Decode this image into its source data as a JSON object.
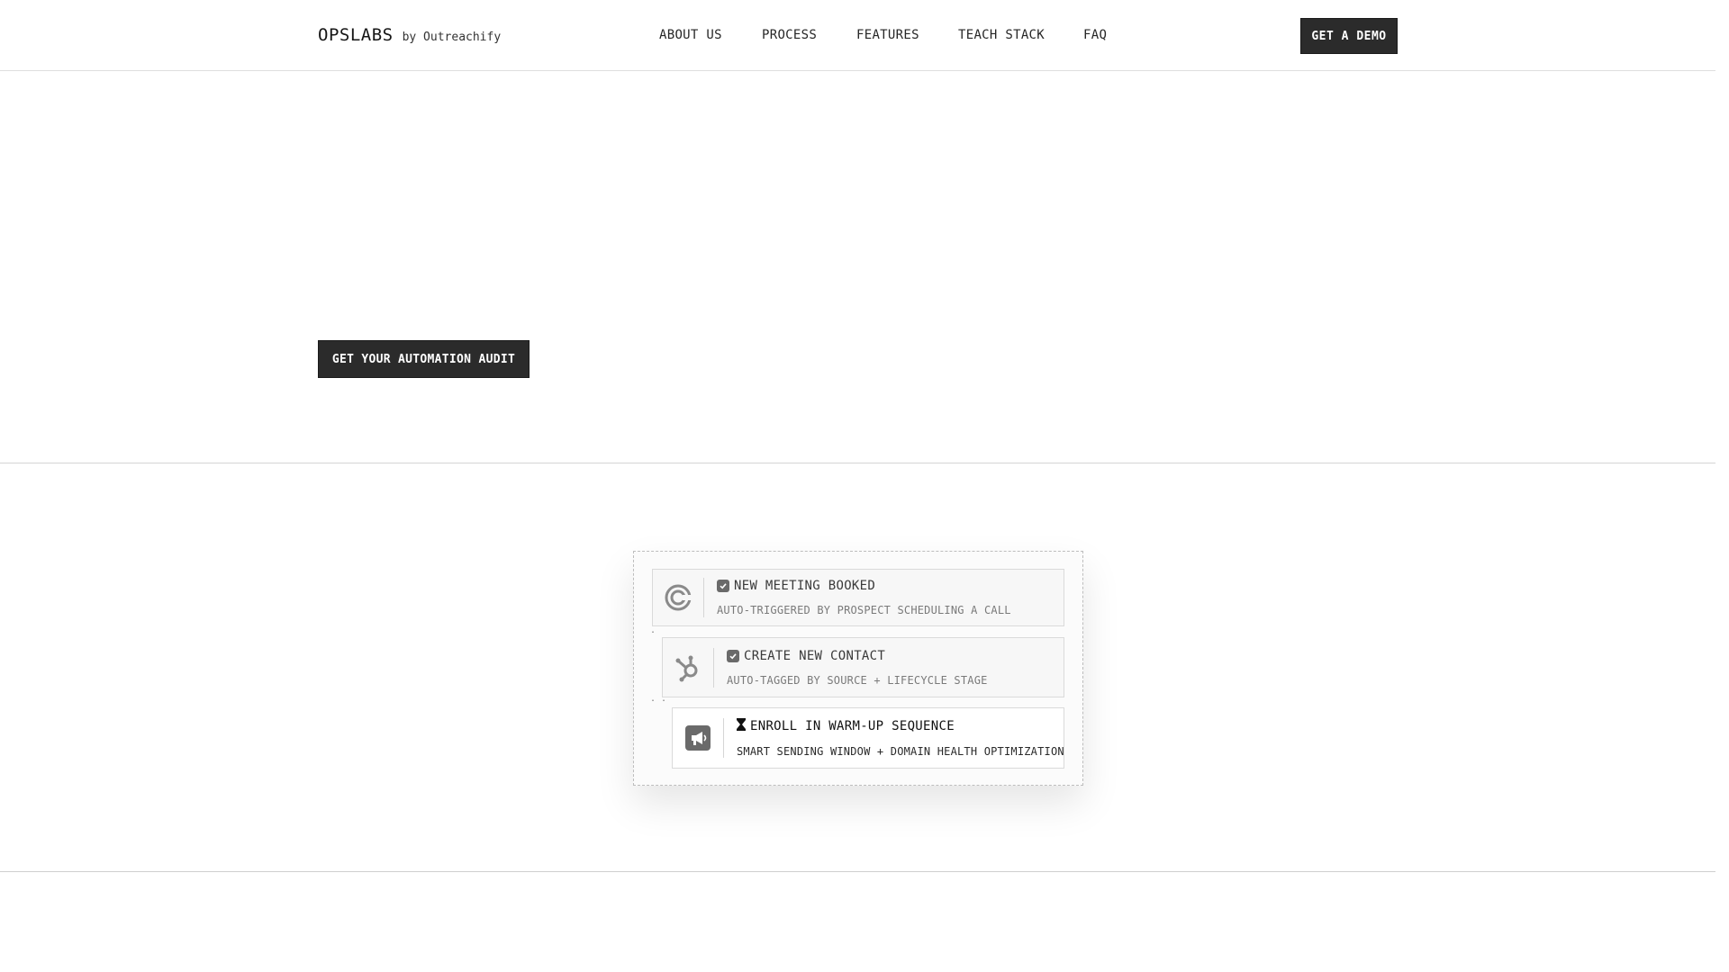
{
  "header": {
    "brand_name": "OPSLABS",
    "brand_by": "by Outreachify",
    "nav": [
      "ABOUT US",
      "PROCESS",
      "FEATURES",
      "TEACH STACK",
      "FAQ"
    ],
    "cta_label": "GET A DEMO"
  },
  "hero": {
    "cta_label": "GET YOUR AUTOMATION AUDIT"
  },
  "workflow": {
    "steps": [
      {
        "icon": "calendly-icon",
        "status": "check-icon",
        "title": "NEW MEETING BOOKED",
        "subtitle": "AUTO-TRIGGERED BY PROSPECT SCHEDULING A CALL"
      },
      {
        "icon": "hubspot-icon",
        "status": "check-icon",
        "title": "CREATE NEW CONTACT",
        "subtitle": "AUTO-TAGGED BY SOURCE + LIFECYCLE STAGE"
      },
      {
        "icon": "megaphone-icon",
        "status": "hourglass-icon",
        "title": "ENROLL IN WARM-UP SEQUENCE",
        "subtitle": "SMART SENDING WINDOW + DOMAIN HEALTH OPTIMIZATION"
      }
    ]
  },
  "colors": {
    "button_bg": "#2b2b2b",
    "button_text": "#ffffff",
    "border": "#dedede",
    "muted_text": "#7a7a7a"
  }
}
